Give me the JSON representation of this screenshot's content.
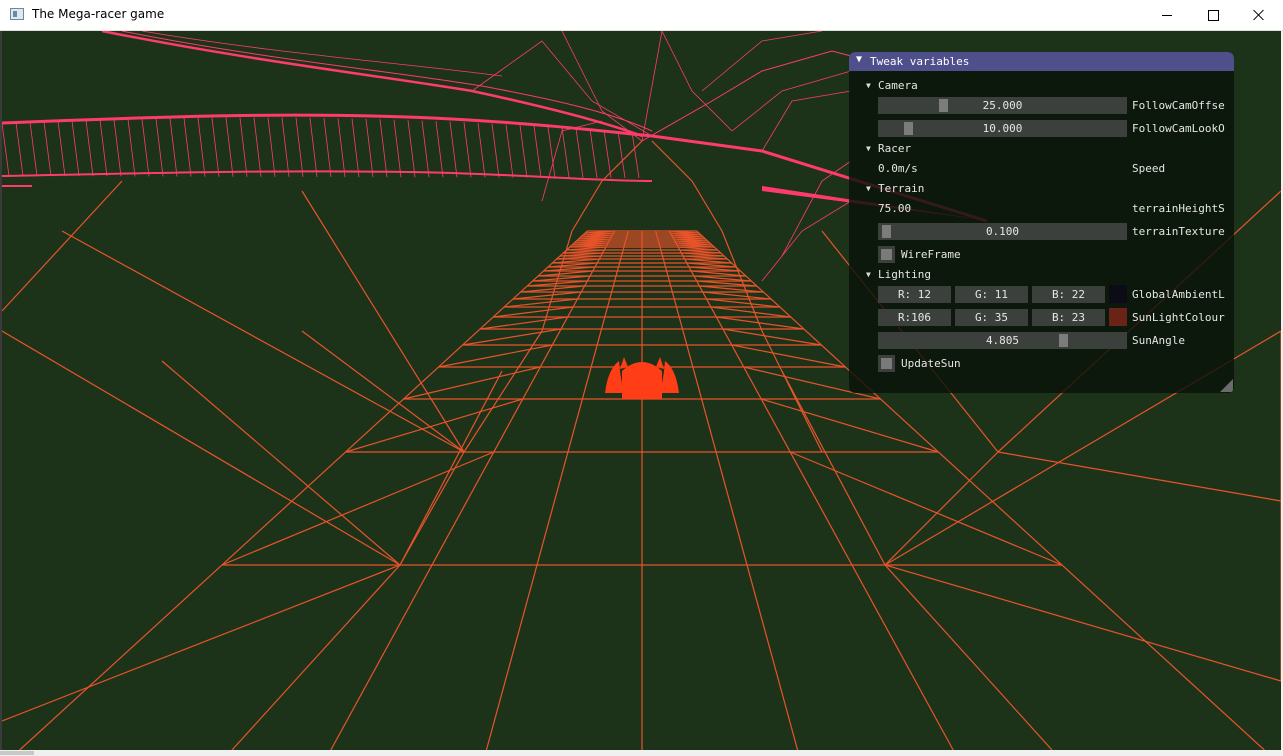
{
  "window": {
    "title": "The Mega-racer game"
  },
  "colors": {
    "ground": "#1c3319",
    "track_wire": "#e8532b",
    "ribbon_wire": "#ff3a6e",
    "racer": "#ff3d16",
    "panel_header": "#4f4f8c",
    "ambient_swatch": "#0c0b16",
    "sun_swatch": "#6a2317"
  },
  "panel": {
    "title": "Tweak variables",
    "camera": {
      "section_title": "Camera",
      "follow_cam_offset": {
        "value": "25.000",
        "label": "FollowCamOffse",
        "fraction": 0.25
      },
      "follow_cam_look": {
        "value": "10.000",
        "label": "FollowCamLookO",
        "fraction": 0.1
      }
    },
    "racer": {
      "section_title": "Racer",
      "speed": {
        "value": "0.0m/s",
        "label": "Speed"
      }
    },
    "terrain": {
      "section_title": "Terrain",
      "height_scale": {
        "value": "75.00",
        "label": "terrainHeightS"
      },
      "texture": {
        "value": "0.100",
        "label": "terrainTexture",
        "fraction": 0.01
      },
      "wireframe": {
        "label": "WireFrame",
        "checked": false
      }
    },
    "lighting": {
      "section_title": "Lighting",
      "ambient": {
        "r": "R: 12",
        "g": "G: 11",
        "b": "B: 22",
        "label": "GlobalAmbientL"
      },
      "sun_colour": {
        "r": "R:106",
        "g": "G: 35",
        "b": "B: 23",
        "label": "SunLightColour"
      },
      "sun_angle": {
        "value": "4.805",
        "label": "SunAngle",
        "fraction": 0.76
      },
      "update_sun": {
        "label": "UpdateSun",
        "checked": false
      }
    }
  }
}
